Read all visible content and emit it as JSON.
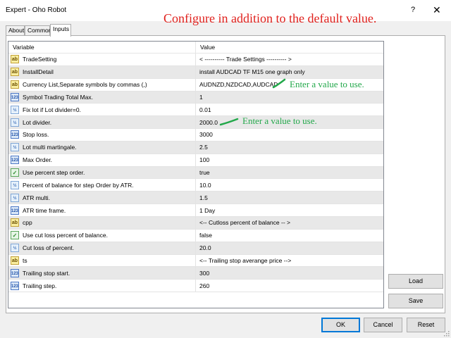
{
  "window": {
    "title": "Expert - Oho Robot",
    "help_glyph": "?",
    "close_glyph": "✕"
  },
  "annotations": {
    "main": "Configure in addition to the default value.",
    "hint1": "Enter a value to use.",
    "hint2": "Enter a value to use."
  },
  "tabs": [
    {
      "label": "About",
      "active": false
    },
    {
      "label": "Common",
      "active": false
    },
    {
      "label": "Inputs",
      "active": true
    }
  ],
  "grid": {
    "col_variable": "Variable",
    "col_value": "Value",
    "rows": [
      {
        "type": "string",
        "type_label": "ab",
        "name": "TradeSetting",
        "value": "< ---------- Trade Settings ---------- >"
      },
      {
        "type": "string",
        "type_label": "ab",
        "name": "InstallDetail",
        "value": "install AUDCAD TF M15 one graph  only"
      },
      {
        "type": "string",
        "type_label": "ab",
        "name": "Currency List,Separate symbols by commas (,)",
        "value": "AUDNZD,NZDCAD,AUDCAD"
      },
      {
        "type": "int",
        "type_label": "123",
        "name": "Symbol Trading Total Max.",
        "value": "1"
      },
      {
        "type": "double",
        "type_label": "½",
        "name": "Fix lot if Lot divider=0.",
        "value": "0.01"
      },
      {
        "type": "double",
        "type_label": "½",
        "name": "Lot divider.",
        "value": "2000.0"
      },
      {
        "type": "int",
        "type_label": "123",
        "name": "Stop loss.",
        "value": "3000"
      },
      {
        "type": "double",
        "type_label": "½",
        "name": "Lot multi martingale.",
        "value": "2.5"
      },
      {
        "type": "int",
        "type_label": "123",
        "name": "Max Order.",
        "value": "100"
      },
      {
        "type": "bool",
        "type_label": "✓",
        "name": "Use percent step order.",
        "value": "true"
      },
      {
        "type": "double",
        "type_label": "½",
        "name": "Percent of balance for step Order by ATR.",
        "value": "10.0"
      },
      {
        "type": "double",
        "type_label": "½",
        "name": "ATR multi.",
        "value": "1.5"
      },
      {
        "type": "int",
        "type_label": "123",
        "name": "ATR time frame.",
        "value": "1 Day"
      },
      {
        "type": "string",
        "type_label": "ab",
        "name": "cpp",
        "value": "<-- Cutloss percent of balance -- >"
      },
      {
        "type": "bool",
        "type_label": "✓",
        "name": "Use cut loss percent of balance.",
        "value": "false"
      },
      {
        "type": "double",
        "type_label": "½",
        "name": "Cut loss of percent.",
        "value": "20.0"
      },
      {
        "type": "string",
        "type_label": "ab",
        "name": "ts",
        "value": "<-- Trailing stop averange price -->"
      },
      {
        "type": "int",
        "type_label": "123",
        "name": "Trailing stop start.",
        "value": "300"
      },
      {
        "type": "int",
        "type_label": "123",
        "name": "Trailing step.",
        "value": "260"
      }
    ]
  },
  "side_buttons": {
    "load": "Load",
    "save": "Save"
  },
  "footer_buttons": {
    "ok": "OK",
    "cancel": "Cancel",
    "reset": "Reset"
  },
  "colors": {
    "annotation_red": "#e0201c",
    "annotation_green": "#22a84a",
    "default_button_border": "#0078d7"
  }
}
